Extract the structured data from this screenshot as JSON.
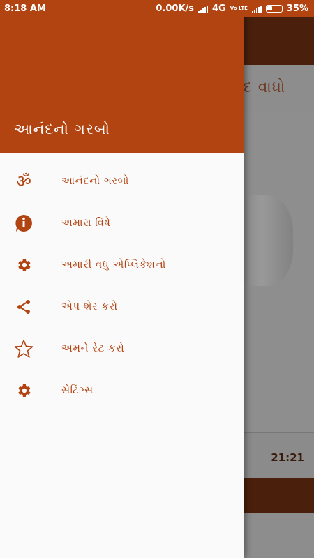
{
  "status_bar": {
    "time": "8:18 AM",
    "speed": "0.00K/s",
    "network": "4G",
    "volte": "Vo LTE",
    "battery": "35%"
  },
  "background": {
    "title": "ંદ વાધો",
    "time": "21:21"
  },
  "drawer": {
    "title": "આનંદનો ગરબો",
    "items": [
      {
        "label": "આનંદનો ગરબો",
        "icon": "om-icon"
      },
      {
        "label": "અમારા વિષે",
        "icon": "info-icon"
      },
      {
        "label": "અમારી વધુ એપ્લિકેશનો",
        "icon": "gear-icon"
      },
      {
        "label": "એપ શેર કરો",
        "icon": "share-icon"
      },
      {
        "label": "અમને રેટ કરો",
        "icon": "star-icon"
      },
      {
        "label": "સેટિંગ્સ",
        "icon": "gear-icon"
      }
    ]
  },
  "colors": {
    "accent": "#b24412",
    "dark_toolbar": "#4a200c",
    "drawer_bg": "#fafafa"
  }
}
